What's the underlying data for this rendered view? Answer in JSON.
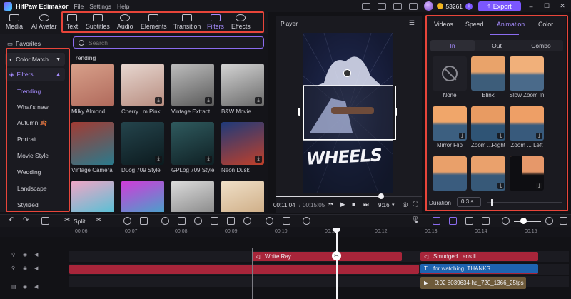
{
  "app": {
    "name": "HitPaw Edimakor",
    "menus": [
      "File",
      "Settings",
      "Help"
    ],
    "coins": "53261",
    "plus": "+",
    "export_label": "Export",
    "window_controls": [
      "–",
      "☐",
      "✕"
    ]
  },
  "toolbar": {
    "media": "Media",
    "ai_avatar": "AI Avatar",
    "text": "Text",
    "subtitles": "Subtitles",
    "audio": "Audio",
    "elements": "Elements",
    "transition": "Transition",
    "filters": "Filters",
    "effects": "Effects"
  },
  "left_panel": {
    "favorites": "Favorites",
    "color_match": "Color Match",
    "filters": "Filters",
    "items": [
      "Trending",
      "What's new",
      "Autumn 🍂",
      "Portrait",
      "Movie Style",
      "Wedding",
      "Landscape",
      "Stylized"
    ]
  },
  "browser": {
    "search_placeholder": "Search",
    "section": "Trending",
    "thumbs": [
      {
        "label": "Milky Almond",
        "colors": [
          "#d8a08a",
          "#b06a5c"
        ],
        "download": false
      },
      {
        "label": "Cherry...m Pink",
        "colors": [
          "#e7d7d0",
          "#b88d80"
        ],
        "download": true
      },
      {
        "label": "Vintage Extract",
        "colors": [
          "#bdbdbd",
          "#5a5a5a"
        ],
        "download": true
      },
      {
        "label": "B&W Movie",
        "colors": [
          "#d4d4d4",
          "#6a6a6a"
        ],
        "download": true
      },
      {
        "label": "Vintage Camera",
        "colors": [
          "#a23b33",
          "#2a7a8c"
        ],
        "download": false
      },
      {
        "label": "DLog 709 Style",
        "colors": [
          "#24444c",
          "#0c1a1e"
        ],
        "download": true
      },
      {
        "label": "GPLog 709 Style",
        "colors": [
          "#2f5a5e",
          "#0f2024"
        ],
        "download": true
      },
      {
        "label": "Neon Dusk",
        "colors": [
          "#1e3a7a",
          "#c0402a"
        ],
        "download": true
      },
      {
        "label": "",
        "colors": [
          "#f2a6c6",
          "#36c6d8"
        ],
        "download": false
      },
      {
        "label": "",
        "colors": [
          "#d33ad8",
          "#2ab8c8"
        ],
        "download": false
      },
      {
        "label": "",
        "colors": [
          "#dcdcdc",
          "#7a7a7a"
        ],
        "download": false
      },
      {
        "label": "",
        "colors": [
          "#f0e0c8",
          "#c8a47a"
        ],
        "download": false
      }
    ],
    "download_glyph": "⤓"
  },
  "player": {
    "title": "Player",
    "overlay_text": "WHEELS",
    "current_time": "00:11:04",
    "total_time": "00:15:05",
    "ratio": "9:16"
  },
  "right_panel": {
    "tabs": [
      "Videos",
      "Speed",
      "Animation",
      "Color"
    ],
    "segments": [
      "In",
      "Out",
      "Combo"
    ],
    "animations": [
      {
        "label": "None"
      },
      {
        "label": "Blink"
      },
      {
        "label": "Slow Zoom In"
      },
      {
        "label": "Mirror Flip"
      },
      {
        "label": "Zoom ...Right"
      },
      {
        "label": "Zoom ... Left"
      },
      {
        "label": ""
      },
      {
        "label": ""
      },
      {
        "label": ""
      }
    ],
    "duration_label": "Duration",
    "duration_value": "0.3 s"
  },
  "timeline": {
    "split_label": "Split",
    "ticks": [
      "00:06",
      "00:07",
      "00:08",
      "00:09",
      "00:10",
      "00:11",
      "00:12",
      "00:13",
      "00:14",
      "00:15"
    ],
    "clips": {
      "white_ray": "White Ray",
      "smudged_lens": "Smudged Lens Ⅱ",
      "thanks_text": "for watching. THANKS",
      "video_file": "0:02 8039634-hd_720_1366_25fps"
    },
    "colors": {
      "effect": "#a8253a",
      "text": "#1d63b0",
      "accent": "#8b6cf0"
    }
  }
}
